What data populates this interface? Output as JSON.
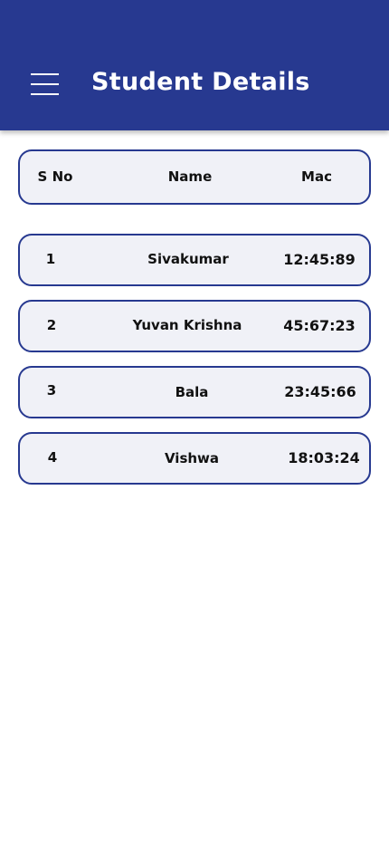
{
  "app_bar": {
    "title": "Student Details",
    "background_color": "#273990",
    "menu_icon": "hamburger-menu-icon"
  },
  "table": {
    "header": {
      "sno": "S No",
      "name": "Name",
      "mac": "Mac"
    },
    "rows": [
      {
        "sno": "1",
        "name": "Sivakumar",
        "mac": "12:45:89"
      },
      {
        "sno": "2",
        "name": "Yuvan Krishna",
        "mac": "45:67:23"
      },
      {
        "sno": "3",
        "name": "Bala",
        "mac": "23:45:66"
      },
      {
        "sno": "4",
        "name": "Vishwa",
        "mac": "18:03:24"
      }
    ],
    "border_color": "#273990",
    "card_background": "#f0f1f7"
  }
}
